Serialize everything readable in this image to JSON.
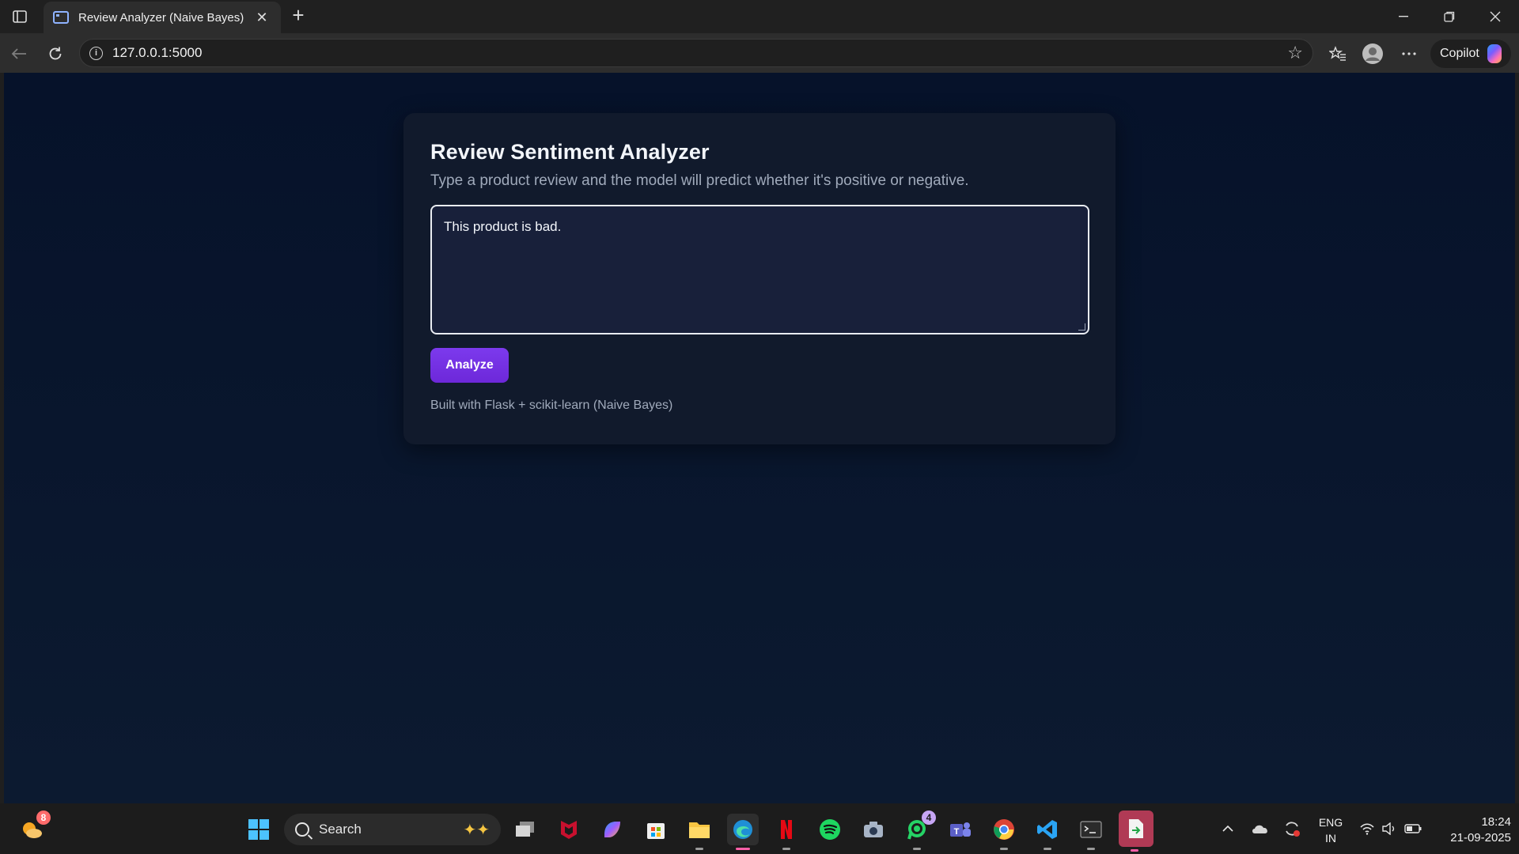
{
  "browser": {
    "tab_title": "Review Analyzer (Naive Bayes)",
    "url": "127.0.0.1:5000",
    "copilot_label": "Copilot"
  },
  "page": {
    "title": "Review Sentiment Analyzer",
    "subtitle": "Type a product review and the model will predict whether it's positive or negative.",
    "review_value": "This product is bad.",
    "analyze_label": "Analyze",
    "footnote": "Built with Flask + scikit-learn (Naive Bayes)",
    "colors": {
      "accent": "#6d28d9",
      "card": "#111a2c",
      "background": "#0a172e"
    }
  },
  "taskbar": {
    "weather_badge": "8",
    "search_label": "Search",
    "whatsapp_badge": "4",
    "lang_line1": "ENG",
    "lang_line2": "IN",
    "time": "18:24",
    "date": "21-09-2025",
    "apps": [
      "start-icon",
      "task-view-icon",
      "mcafee-icon",
      "copilot-icon",
      "store-icon",
      "file-explorer-icon",
      "edge-icon",
      "netflix-icon",
      "spotify-icon",
      "camera-icon",
      "whatsapp-icon",
      "teams-icon",
      "chrome-icon",
      "vscode-icon",
      "terminal-icon",
      "app-icon"
    ]
  }
}
